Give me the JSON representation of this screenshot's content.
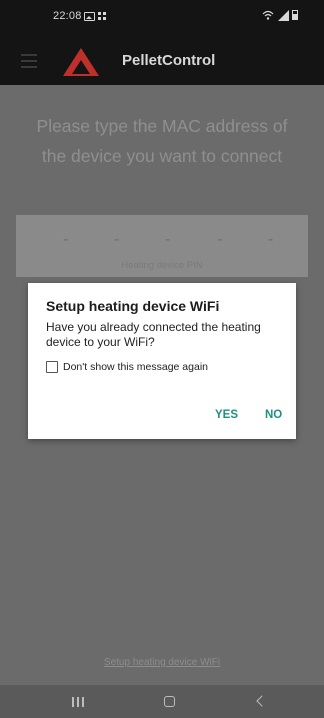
{
  "status_bar": {
    "time": "22:08",
    "icons": [
      "gallery-icon",
      "grid-icon",
      "wifi-icon",
      "signal-icon",
      "battery-icon"
    ]
  },
  "app_bar": {
    "title": "PelletControl",
    "menu_icon": "hamburger-menu-icon",
    "logo_icon": "triangle-logo",
    "logo_color": "#c0302a"
  },
  "main": {
    "instruction": "Please type the MAC address of the device you want to connect",
    "mac_field": {
      "segments": [
        "-",
        "-",
        "-",
        "-",
        "-"
      ],
      "label": "Heating device PIN"
    },
    "setup_link": "Setup heating device WiFi"
  },
  "dialog": {
    "title": "Setup heating device WiFi",
    "message": "Have you already connected the heating device to your WiFi?",
    "checkbox_label": "Don't show this message again",
    "checkbox_checked": false,
    "yes_label": "YES",
    "no_label": "NO",
    "accent_color": "#1f8f86"
  },
  "nav_bar": {
    "buttons": [
      "recent-apps-icon",
      "home-icon",
      "back-icon"
    ]
  }
}
